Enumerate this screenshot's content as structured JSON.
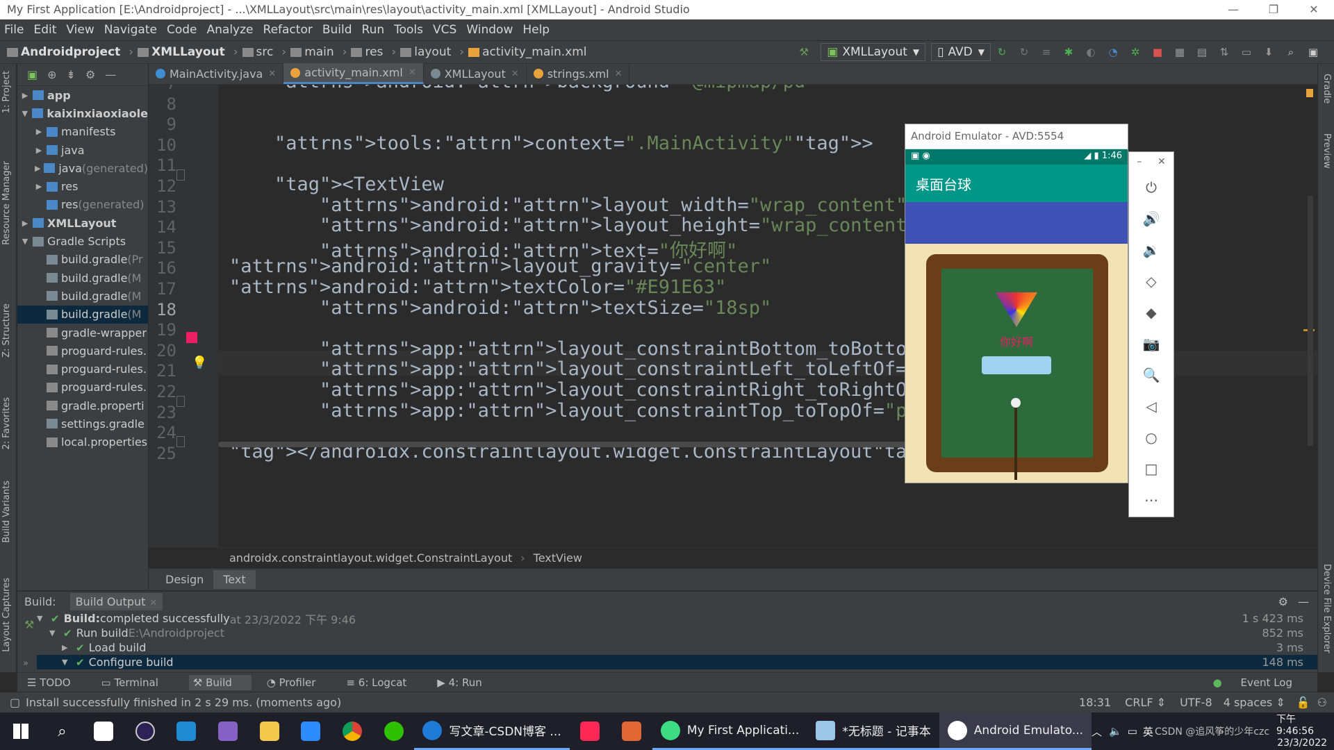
{
  "window": {
    "title": "My First Application [E:\\Androidproject] - ...\\XMLLayout\\src\\main\\res\\layout\\activity_main.xml [XMLLayout] - Android Studio",
    "minimize": "—",
    "restore": "❐",
    "close": "✕"
  },
  "menu": [
    "File",
    "Edit",
    "View",
    "Navigate",
    "Code",
    "Analyze",
    "Refactor",
    "Build",
    "Run",
    "Tools",
    "VCS",
    "Window",
    "Help"
  ],
  "nav": {
    "crumbs": [
      "Androidproject",
      "XMLLayout",
      "src",
      "main",
      "res",
      "layout",
      "activity_main.xml"
    ],
    "run_config": "XMLLayout",
    "device": "AVD"
  },
  "project_tree": [
    {
      "label": "app",
      "extra": "",
      "depth": 0,
      "arrow": "▶",
      "icon": "folder"
    },
    {
      "label": "kaixinxiaoxiaole",
      "extra": "",
      "depth": 0,
      "arrow": "▼",
      "icon": "folder"
    },
    {
      "label": "manifests",
      "extra": "",
      "depth": 1,
      "arrow": "▶",
      "icon": "folder"
    },
    {
      "label": "java",
      "extra": "",
      "depth": 1,
      "arrow": "▶",
      "icon": "folder"
    },
    {
      "label": "java",
      "extra": " (generated)",
      "depth": 1,
      "arrow": "▶",
      "icon": "folder"
    },
    {
      "label": "res",
      "extra": "",
      "depth": 1,
      "arrow": "▶",
      "icon": "folder"
    },
    {
      "label": "res",
      "extra": " (generated)",
      "depth": 1,
      "arrow": "",
      "icon": "folder"
    },
    {
      "label": "XMLLayout",
      "extra": "",
      "depth": 0,
      "arrow": "▶",
      "icon": "folder"
    },
    {
      "label": "Gradle Scripts",
      "extra": "",
      "depth": 0,
      "arrow": "▼",
      "icon": "gradle"
    },
    {
      "label": "build.gradle",
      "extra": " (Pr",
      "depth": 1,
      "arrow": "",
      "icon": "gradle"
    },
    {
      "label": "build.gradle",
      "extra": " (M",
      "depth": 1,
      "arrow": "",
      "icon": "gradle"
    },
    {
      "label": "build.gradle",
      "extra": " (M",
      "depth": 1,
      "arrow": "",
      "icon": "gradle"
    },
    {
      "label": "build.gradle",
      "extra": " (M",
      "depth": 1,
      "arrow": "",
      "icon": "gradle",
      "selected": true
    },
    {
      "label": "gradle-wrapper",
      "extra": "",
      "depth": 1,
      "arrow": "",
      "icon": "file"
    },
    {
      "label": "proguard-rules.",
      "extra": "",
      "depth": 1,
      "arrow": "",
      "icon": "file"
    },
    {
      "label": "proguard-rules.",
      "extra": "",
      "depth": 1,
      "arrow": "",
      "icon": "file"
    },
    {
      "label": "proguard-rules.",
      "extra": "",
      "depth": 1,
      "arrow": "",
      "icon": "file"
    },
    {
      "label": "gradle.properti",
      "extra": "",
      "depth": 1,
      "arrow": "",
      "icon": "file"
    },
    {
      "label": "settings.gradle",
      "extra": "",
      "depth": 1,
      "arrow": "",
      "icon": "gradle"
    },
    {
      "label": "local.properties",
      "extra": "",
      "depth": 1,
      "arrow": "",
      "icon": "file"
    }
  ],
  "left_tabs": [
    "1: Project",
    "Resource Manager",
    "Z: Structure",
    "2: Favorites",
    "Build Variants",
    "Layout Captures"
  ],
  "right_tabs": [
    "Gradle",
    "Preview",
    "Device File Explorer"
  ],
  "editor_tabs": [
    {
      "label": "MainActivity.java",
      "color": "#3d8fd1",
      "active": false
    },
    {
      "label": "activity_main.xml",
      "color": "#e8a33d",
      "active": true
    },
    {
      "label": "XMLLayout",
      "color": "#7a8a92",
      "active": false
    },
    {
      "label": "strings.xml",
      "color": "#e8a33d",
      "active": false
    }
  ],
  "code_lines": [
    {
      "num": "7",
      "text": "    android:background=\"@mipmap/pd\""
    },
    {
      "num": "8",
      "text": ""
    },
    {
      "num": "9",
      "text": ""
    },
    {
      "num": "10",
      "text": "    tools:context=\".MainActivity\">"
    },
    {
      "num": "11",
      "text": ""
    },
    {
      "num": "12",
      "text": "    <TextView"
    },
    {
      "num": "13",
      "text": "        android:layout_width=\"wrap_content\""
    },
    {
      "num": "14",
      "text": "        android:layout_height=\"wrap_content\""
    },
    {
      "num": "15",
      "text": "        android:text=\"你好啊\""
    },
    {
      "num": "16",
      "text": "android:layout_gravity=\"center\""
    },
    {
      "num": "17",
      "text": "android:textColor=\"#E91E63\""
    },
    {
      "num": "18",
      "text": "        android:textSize=\"18sp\""
    },
    {
      "num": "19",
      "text": ""
    },
    {
      "num": "20",
      "text": "        app:layout_constraintBottom_toBottomOf=\"parent\""
    },
    {
      "num": "21",
      "text": "        app:layout_constraintLeft_toLeftOf=\"parent\""
    },
    {
      "num": "22",
      "text": "        app:layout_constraintRight_toRightOf=\"parent\""
    },
    {
      "num": "23",
      "text": "        app:layout_constraintTop_toTopOf=\"parent\" />"
    },
    {
      "num": "24",
      "text": ""
    },
    {
      "num": "25",
      "text": "</androidx.constraintlayout.widget.ConstraintLayout>"
    }
  ],
  "swatch_color": "#E91E63",
  "editor_breadcrumb": [
    "androidx.constraintlayout.widget.ConstraintLayout",
    "TextView"
  ],
  "design_tabs": [
    "Design",
    "Text"
  ],
  "build": {
    "label": "Build:",
    "tab": "Build Output",
    "rows": [
      {
        "text": "Build:",
        "rest": " completed successfully",
        "dim": " at 23/3/2022 下午 9:46",
        "time": "1 s 423 ms",
        "depth": 0,
        "arrow": "▼",
        "bold": true
      },
      {
        "text": "Run build",
        "rest": "",
        "dim": " E:\\Androidproject",
        "time": "852 ms",
        "depth": 1,
        "arrow": "▼"
      },
      {
        "text": "Load build",
        "rest": "",
        "dim": "",
        "time": "3 ms",
        "depth": 2,
        "arrow": "▶"
      },
      {
        "text": "Configure build",
        "rest": "",
        "dim": "",
        "time": "148 ms",
        "depth": 2,
        "arrow": "▼",
        "selected": true
      }
    ]
  },
  "tool_windows": [
    "TODO",
    "Terminal",
    "Build",
    "Profiler",
    "6: Logcat",
    "4: Run"
  ],
  "event_log": "Event Log",
  "status": {
    "message": "Install successfully finished in 2 s 29 ms. (moments ago)",
    "position": "18:31",
    "line_sep": "CRLF ⇕",
    "encoding": "UTF-8",
    "indent": "4 spaces ⇕"
  },
  "emulator": {
    "title": "Android Emulator - AVD:5554",
    "clock": "1:46",
    "app_title": "桌面台球",
    "greeting": "你好啊",
    "controls": [
      "⏻",
      "🔊",
      "🔉",
      "◇",
      "◆",
      "📷",
      "🔍",
      "◁",
      "○",
      "□",
      "⋯"
    ]
  },
  "taskbar": {
    "apps": [
      {
        "label": "写文章-CSDN博客 ...",
        "color": "#1e7bd6"
      },
      {
        "label": "My First Applicati...",
        "color": "#3ddc84"
      },
      {
        "label": "*无标题 - 记事本",
        "color": "#9bc6e8"
      },
      {
        "label": "Android Emulato...",
        "color": "#3ddc84"
      }
    ],
    "tray_text": "CSDN @追风筝的少年czc",
    "ime": "英",
    "time": "下午 9:46:56",
    "date": "23/3/2022"
  }
}
